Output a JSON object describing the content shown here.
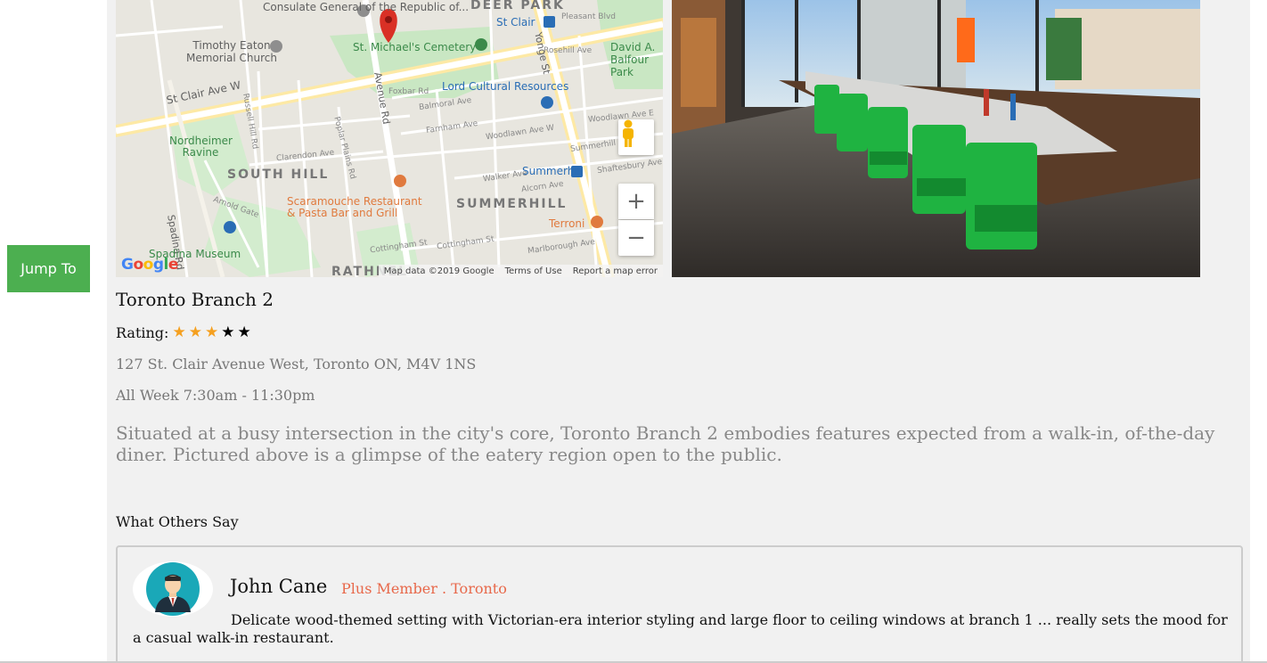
{
  "jump_button": {
    "label": "Jump To",
    "color": "#4caf50"
  },
  "map": {
    "labels": {
      "consulate": "Consulate General of the Republic of...",
      "deer_park": "DEER PARK",
      "st_clair_station": "St Clair",
      "pleasant_blvd": "Pleasant Blvd",
      "timothy_eaton": "Timothy Eaton Memorial Church",
      "st_michaels": "St. Michael's Cemetery",
      "rosehill": "Rosehill Ave",
      "david_balfour": "David A. Balfour Park",
      "st_clair_ave_w": "St Clair Ave W",
      "lord_cultural": "Lord Cultural Resources",
      "foxbar": "Foxbar Rd",
      "balmoral": "Balmoral Ave",
      "farnham": "Farnham Ave",
      "woodlawn_w": "Woodlawn Ave W",
      "woodlawn_e": "Woodlawn Ave E",
      "nordheimer": "Nordheimer Ravine",
      "summerhill_ave": "Summerhill Ave",
      "south_hill": "SOUTH HILL",
      "summerhill_station": "Summerhill",
      "shaftesbury": "Shaftesbury Ave",
      "walker": "Walker Ave",
      "alcorn": "Alcorn Ave",
      "scaramouche": "Scaramouche Restaurant & Pasta Bar and Grill",
      "summerhill_area": "SUMMERHILL",
      "terroni": "Terroni",
      "spadina_rd": "Spadina Rd",
      "arnold_gate": "Arnold Gate",
      "avenue_rd": "Avenue Rd",
      "yonge_st": "Yonge St",
      "clarendon": "Clarendon Ave",
      "poplar_plains": "Poplar Plains Rd",
      "russell_hill": "Russell Hill Rd",
      "cottingham": "Cottingham St",
      "marlborough": "Marlborough Ave",
      "spadina_museum": "Spadina Museum",
      "rathnelly": "RATHNEL"
    },
    "footer": {
      "data": "Map data ©2019 Google",
      "terms": "Terms of Use",
      "report": "Report a map error"
    },
    "google_logo": "Google"
  },
  "branch": {
    "title": "Toronto Branch 2",
    "rating_label": "Rating:",
    "rating": 3,
    "rating_max": 5,
    "address": "127 St. Clair Avenue West, Toronto ON, M4V 1NS",
    "hours": "All Week 7:30am - 11:30pm",
    "description": "Situated at a busy intersection in the city's core, Toronto Branch 2 embodies features expected from a walk-in, of-the-day diner. Pictured above is a glimpse of the eatery region open to the public."
  },
  "reviews_section": {
    "title": "What Others Say",
    "reviews": [
      {
        "name": "John Cane",
        "meta": "Plus Member . Toronto",
        "text": "Delicate wood-themed setting with Victorian-era interior styling and large floor to ceiling windows at branch 1 ... really sets the mood for a casual walk-in restaurant."
      }
    ]
  },
  "colors": {
    "accent_orange": "#e8684a",
    "star_on": "#f5a020",
    "panel_bg": "#f1f1f1"
  }
}
